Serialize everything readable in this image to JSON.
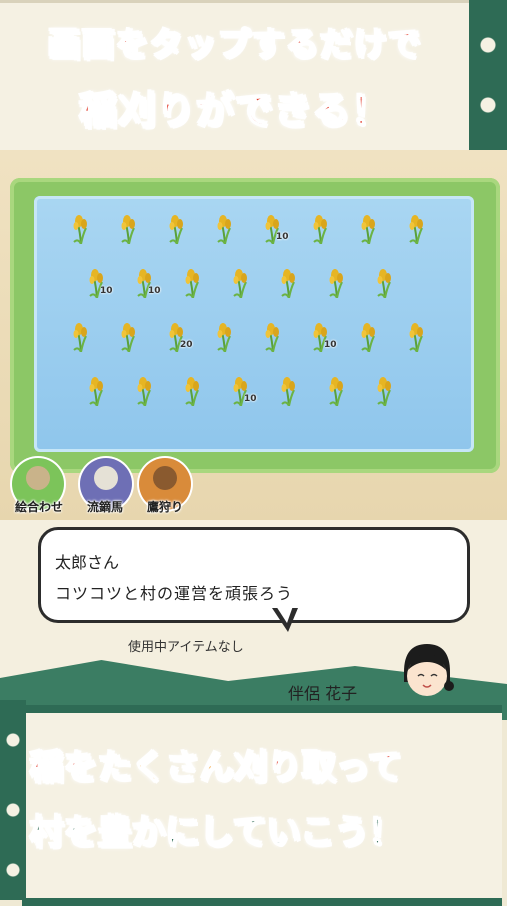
{
  "banner_top": {
    "line1": "画面をタップするだけで",
    "line2": "稲刈りができる！"
  },
  "field": {
    "rows": [
      [
        "",
        "",
        "",
        "",
        "10",
        "",
        "",
        ""
      ],
      [
        "10",
        "10",
        "",
        "",
        "",
        "",
        ""
      ],
      [
        "",
        "",
        "20",
        "",
        "",
        "10",
        "",
        ""
      ],
      [
        "",
        "",
        "",
        "10",
        "",
        "",
        ""
      ]
    ]
  },
  "items": [
    {
      "label": "絵合わせ",
      "icon": "farmer-icon",
      "color": "#7cc45a"
    },
    {
      "label": "流鏑馬",
      "icon": "archer-icon",
      "color": "#6e6fb5"
    },
    {
      "label": "鷹狩り",
      "icon": "hawk-icon",
      "color": "#d98b3a"
    }
  ],
  "dialog": {
    "speaker": "太郎さん",
    "message": "コツコツと村の運営を頑張ろう",
    "item_status": "使用中アイテムなし",
    "character_name": "伴侶 花子"
  },
  "banner_bottom": {
    "line1_a": "稲を",
    "line1_b": "たくさん",
    "line1_c": "刈り取って",
    "line2": "村を豊かにしていこう！"
  }
}
